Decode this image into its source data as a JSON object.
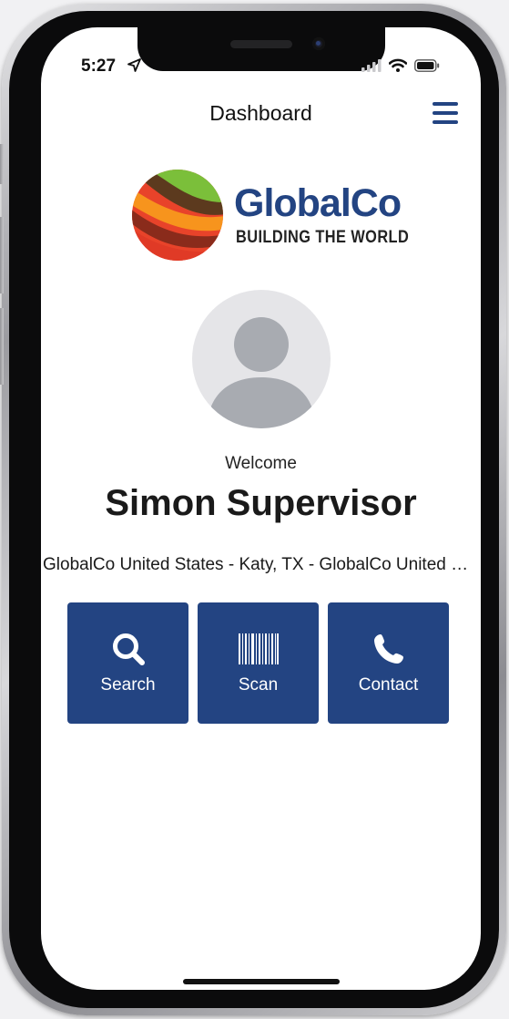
{
  "status_bar": {
    "time": "5:27"
  },
  "nav": {
    "title": "Dashboard",
    "menu_icon": "hamburger-menu-icon"
  },
  "logo": {
    "brand": "GlobalCo",
    "tagline": "BUILDING THE WORLD"
  },
  "profile": {
    "welcome": "Welcome",
    "name": "Simon Supervisor",
    "location": "GlobalCo United States - Katy, TX - GlobalCo United States"
  },
  "actions": [
    {
      "label": "Search",
      "icon": "search-icon"
    },
    {
      "label": "Scan",
      "icon": "barcode-icon"
    },
    {
      "label": "Contact",
      "icon": "phone-icon"
    }
  ],
  "colors": {
    "primary": "#234482",
    "background": "#ffffff",
    "avatar_bg": "#e5e5e8",
    "avatar_fg": "#a8abb1"
  }
}
